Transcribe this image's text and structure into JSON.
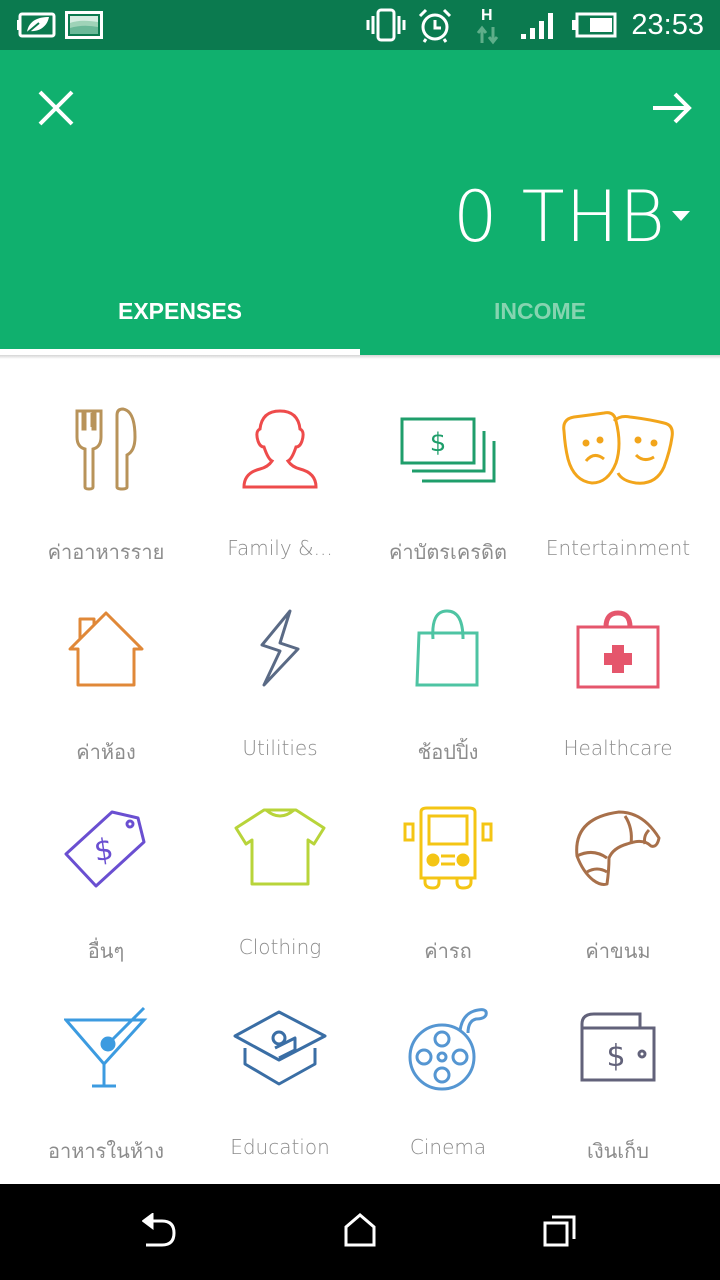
{
  "status_bar": {
    "left_icons": [
      "battery-saver-leaf-icon",
      "gallery-image-icon"
    ],
    "right_icons": [
      "vibrate-icon",
      "alarm-clock-icon",
      "network-h-data-icon",
      "signal-strength-icon",
      "battery-icon"
    ],
    "network_type": "H",
    "time": "23:53"
  },
  "header": {
    "close_icon": "close-icon",
    "next_icon": "arrow-right-icon",
    "amount": "0 THB",
    "amount_dropdown_icon": "caret-down-icon",
    "tabs": [
      {
        "label": "EXPENSES",
        "active": true
      },
      {
        "label": "INCOME",
        "active": false
      }
    ],
    "brand_color": "#10b06e",
    "status_bar_color": "#0b7a4f"
  },
  "categories": [
    {
      "label": "ค่าอาหารราย",
      "icon": "fork-knife-icon",
      "color": "#b8935a"
    },
    {
      "label": "Family &...",
      "icon": "person-icon",
      "color": "#ee4b4b"
    },
    {
      "label": "ค่าบัตรเครดิต",
      "icon": "money-bills-icon",
      "color": "#1f9e6b"
    },
    {
      "label": "Entertainment",
      "icon": "theater-masks-icon",
      "color": "#f2a51b"
    },
    {
      "label": "ค่าห้อง",
      "icon": "house-icon",
      "color": "#e08838"
    },
    {
      "label": "Utilities",
      "icon": "lightning-bolt-icon",
      "color": "#5a6a85"
    },
    {
      "label": "ช้อปปิ้ง",
      "icon": "shopping-bag-icon",
      "color": "#4ec4a3"
    },
    {
      "label": "Healthcare",
      "icon": "first-aid-kit-icon",
      "color": "#e5566c"
    },
    {
      "label": "อื่นๆ",
      "icon": "price-tag-icon",
      "color": "#6a4fd1"
    },
    {
      "label": "Clothing",
      "icon": "t-shirt-icon",
      "color": "#b8d43a"
    },
    {
      "label": "ค่ารถ",
      "icon": "bus-icon",
      "color": "#f4c514"
    },
    {
      "label": "ค่าขนม",
      "icon": "croissant-icon",
      "color": "#a8704a"
    },
    {
      "label": "อาหารในห้าง",
      "icon": "cocktail-icon",
      "color": "#3c9be0"
    },
    {
      "label": "Education",
      "icon": "graduation-cap-icon",
      "color": "#3a6ea5"
    },
    {
      "label": "Cinema",
      "icon": "film-reel-icon",
      "color": "#5596d2"
    },
    {
      "label": "เงินเก็บ",
      "icon": "wallet-icon",
      "color": "#62627a"
    }
  ],
  "nav_bar": {
    "buttons": [
      "back-icon",
      "home-icon",
      "recent-apps-icon"
    ]
  }
}
